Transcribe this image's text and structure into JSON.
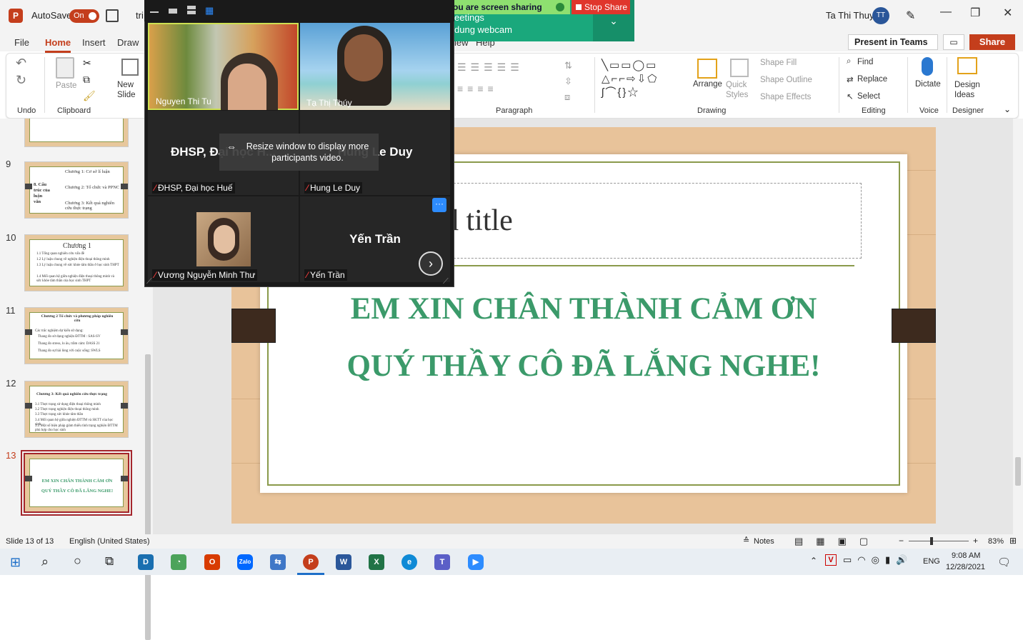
{
  "app": {
    "logo": "P",
    "autosave_label": "AutoSave",
    "autosave_state": "On",
    "doc_title_fragment": "tri",
    "user_name": "Ta Thi Thuy",
    "user_initials": "TT"
  },
  "tabs": [
    "File",
    "Home",
    "Insert",
    "Draw",
    "iew",
    "Help"
  ],
  "header_buttons": {
    "present_teams": "Present in Teams",
    "share": "Share"
  },
  "ribbon": {
    "undo_label": "Undo",
    "clipboard_label": "Clipboard",
    "paste": "Paste",
    "new_slide": "New Slide",
    "paragraph_label": "Paragraph",
    "drawing_label": "Drawing",
    "arrange": "Arrange",
    "quick_styles": "Quick Styles",
    "shape_fill": "Shape Fill",
    "shape_outline": "Shape Outline",
    "shape_effects": "Shape Effects",
    "editing_label": "Editing",
    "find": "Find",
    "replace": "Replace",
    "select": "Select",
    "voice_label": "Voice",
    "dictate": "Dictate",
    "designer_label": "Designer",
    "design_ideas": "Design Ideas"
  },
  "thumbnails": [
    {
      "num": "9",
      "lines": [
        "8. Cấu trúc của luận văn",
        "Chương 1: Cơ sở lí luận",
        "Chương 2: Tổ chức và PPNC",
        "Chương 3: Kết quả nghiên cứu thực trạng"
      ]
    },
    {
      "num": "10",
      "title": "Chương 1",
      "lines": [
        "1.1 Tổng quan nghiên cứu vấn đề",
        "1.2 Lý luận chung về nghiện điện thoại thông minh",
        "1.3 Lý luận chung về sức khỏe tâm thần ở học sinh THPT",
        "1.4 Mối quan hệ giữa nghiện điện thoại thông minh và sức khỏe tâm thần của học sinh THPT"
      ]
    },
    {
      "num": "11",
      "title": "Chương 2 Tổ chức và phương pháp nghiên cứu",
      "lines": [
        "Các trắc nghiệm dự kiến sử dụng:",
        "Thang đo sử dụng nghiện ĐTTM : SAS-SV",
        "Thang đo stress, lo âu, trầm cảm: DASS 21",
        "Thang đo sự hài lòng với cuộc sống: SWLS"
      ]
    },
    {
      "num": "12",
      "title": "Chương 3: Kết quả nghiên cứu thực trạng",
      "lines": [
        "3.1 Thực trạng sử dụng điện thoại thông minh",
        "3.2 Thực trạng nghiện điện thoại thông minh",
        "3.3 Thực trạng sức khỏe tâm thần",
        "3.4 Mối quan hệ giữa nghiện ĐTTM và SKTT của học sinh",
        "3.5 Một số biện pháp giảm thiểu tình trạng nghiện ĐTTM phù hợp cho học sinh"
      ]
    },
    {
      "num": "13",
      "lines": [
        "EM XIN CHÂN THÀNH CẢM ƠN",
        "QUÝ THẦY CÔ ĐÃ LẮNG NGHE!"
      ]
    }
  ],
  "slide": {
    "title_placeholder": "d title",
    "line1": "EM XIN CHÂN THÀNH CẢM ƠN",
    "line2": "QUÝ THẦY CÔ ĐÃ LẮNG NGHE!"
  },
  "status": {
    "slide_info": "Slide 13 of 13",
    "language": "English (United States)",
    "notes": "Notes",
    "zoom": "83%"
  },
  "zoom_meeting": {
    "banner_status": "ou are screen sharing",
    "stop_share": "Stop Share",
    "banner_line1": "eetings",
    "banner_line2": "dung webcam",
    "hint": "Resize window to display more participants video.",
    "participants": [
      {
        "name": "Nguyen Thi Tu",
        "muted": false
      },
      {
        "name": "Tạ Thị Thúy",
        "muted": false
      },
      {
        "name": "ĐHSP, Đại học Huế",
        "muted": true,
        "display": "ĐHSP, Đại học H..."
      },
      {
        "name": "Hung Le Duy",
        "muted": true,
        "display": "Hung Le Duy"
      },
      {
        "name": "Vương Nguyễn Minh Thư",
        "muted": true
      },
      {
        "name": "Yến Trần",
        "muted": true,
        "display": "Yến Trần"
      }
    ]
  },
  "taskbar": {
    "lang": "ENG",
    "time": "9:08 AM",
    "date": "12/28/2021"
  },
  "colors": {
    "accent": "#c43e1c",
    "slide_text": "#3b9a6a",
    "zoom_green": "#1aa87c"
  }
}
